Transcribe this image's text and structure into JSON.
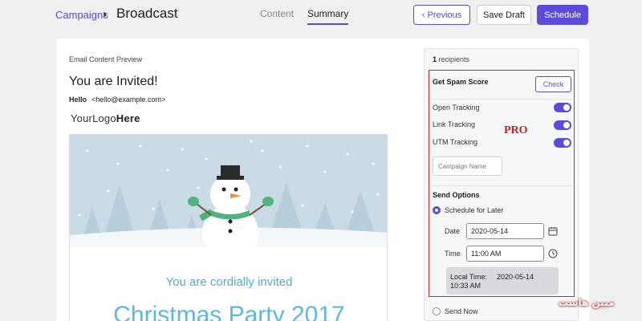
{
  "header": {
    "breadcrumb": "Campaigns",
    "breadcrumb_separator": "›",
    "title": "Broadcast",
    "tabs": [
      {
        "label": "Content",
        "active": false
      },
      {
        "label": "Summary",
        "active": true
      }
    ],
    "previous_label": "‹ Previous",
    "save_draft_label": "Save Draft",
    "schedule_label": "Schedule"
  },
  "preview": {
    "section_label": "Email Content Preview",
    "subject": "You are Invited!",
    "from_name": "Hello",
    "from_email": "<hello@example.com>",
    "logo_regular": "YourLogo",
    "logo_bold": "Here",
    "cordial_text": "You are cordially invited",
    "event_title": "Christmas Party 2017"
  },
  "sidebar": {
    "recipients_count": "1",
    "recipients_label": " recipients",
    "spam_score_label": "Get Spam Score",
    "check_label": "Check",
    "toggles": [
      {
        "label": "Open Tracking",
        "on": true
      },
      {
        "label": "Link Tracking",
        "on": true
      },
      {
        "label": "UTM Tracking",
        "on": true
      }
    ],
    "campaign_name_placeholder": "Campaign Name",
    "pro_label": "PRO",
    "send_options_label": "Send Options",
    "schedule_later_label": "Schedule for Later",
    "date_label": "Date",
    "date_value": "2020-05-14",
    "time_label": "Time",
    "time_value": "11:00 AM",
    "local_time_label": "Local Time:",
    "local_date": "2020-05-14",
    "local_time": "10:33 AM",
    "send_now_label": "Send Now"
  },
  "watermark": "مبین هاست",
  "colors": {
    "accent": "#5b4bdb",
    "pro_red": "#e32222",
    "sky": "#c9dce6",
    "invite_blue": "#5aa7d6"
  }
}
